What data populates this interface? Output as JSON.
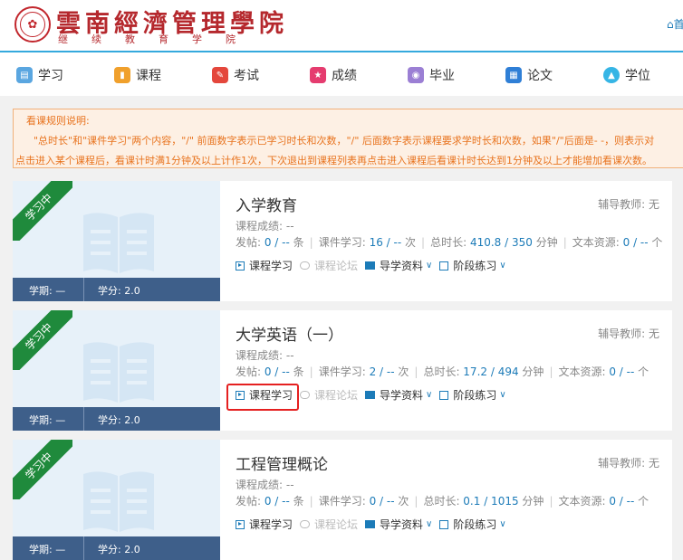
{
  "header": {
    "logo_text": "雲南經濟管理學院",
    "logo_subtitle": "继续教育学院",
    "home_label": "首"
  },
  "nav": {
    "items": [
      {
        "label": "学习",
        "color": "#5aa6e0",
        "icon": "study-icon"
      },
      {
        "label": "课程",
        "color": "#f0a02c",
        "icon": "course-icon"
      },
      {
        "label": "考试",
        "color": "#e4473c",
        "icon": "exam-icon"
      },
      {
        "label": "成绩",
        "color": "#e53c6f",
        "icon": "score-icon"
      },
      {
        "label": "毕业",
        "color": "#9b7fd4",
        "icon": "graduate-icon"
      },
      {
        "label": "论文",
        "color": "#2f7fd6",
        "icon": "paper-icon"
      },
      {
        "label": "学位",
        "color": "#36b5e5",
        "icon": "degree-icon"
      }
    ]
  },
  "notice": {
    "title": "看课规则说明:",
    "line1": "\"总时长\"和\"课件学习\"两个内容，\"/\" 前面数字表示已学习时长和次数，\"/\" 后面数字表示课程要求学时长和次数，如果\"/\"后面是- -，则表示对",
    "line2": "点击进入某个课程后，看课计时满1分钟及以上计作1次，下次退出到课程列表再点击进入课程后看课计时长达到1分钟及以上才能增加看课次数。"
  },
  "labels": {
    "status_ribbon": "学习中",
    "semester_label": "学期: —",
    "tutor_prefix": "辅导教师: ",
    "grade_label": "课程成绩: --",
    "posts_label": "发帖: ",
    "posts_unit": "条",
    "coursework_label": "课件学习: ",
    "coursework_unit": "次",
    "duration_label": "总时长: ",
    "duration_unit": "分钟",
    "text_label": "文本资源: ",
    "text_unit": "个",
    "link_study": "课程学习",
    "link_forum": "课程论坛",
    "link_materials": "导学资料",
    "link_practice": "阶段练习"
  },
  "courses": [
    {
      "title": "入学教育",
      "tutor": "无",
      "credit_label": "学分: 2.0",
      "posts": "0 / --",
      "coursework": "16 / --",
      "duration": "410.8 / 350",
      "text": "0 / --"
    },
    {
      "title": "大学英语（一）",
      "tutor": "无",
      "credit_label": "学分: 2.0",
      "posts": "0 / --",
      "coursework": "2 / --",
      "duration": "17.2 / 494",
      "text": "0 / --"
    },
    {
      "title": "工程管理概论",
      "tutor": "无",
      "credit_label": "学分: 2.0",
      "posts": "0 / --",
      "coursework": "0 / --",
      "duration": "0.1 / 1015",
      "text": "0 / --"
    }
  ]
}
